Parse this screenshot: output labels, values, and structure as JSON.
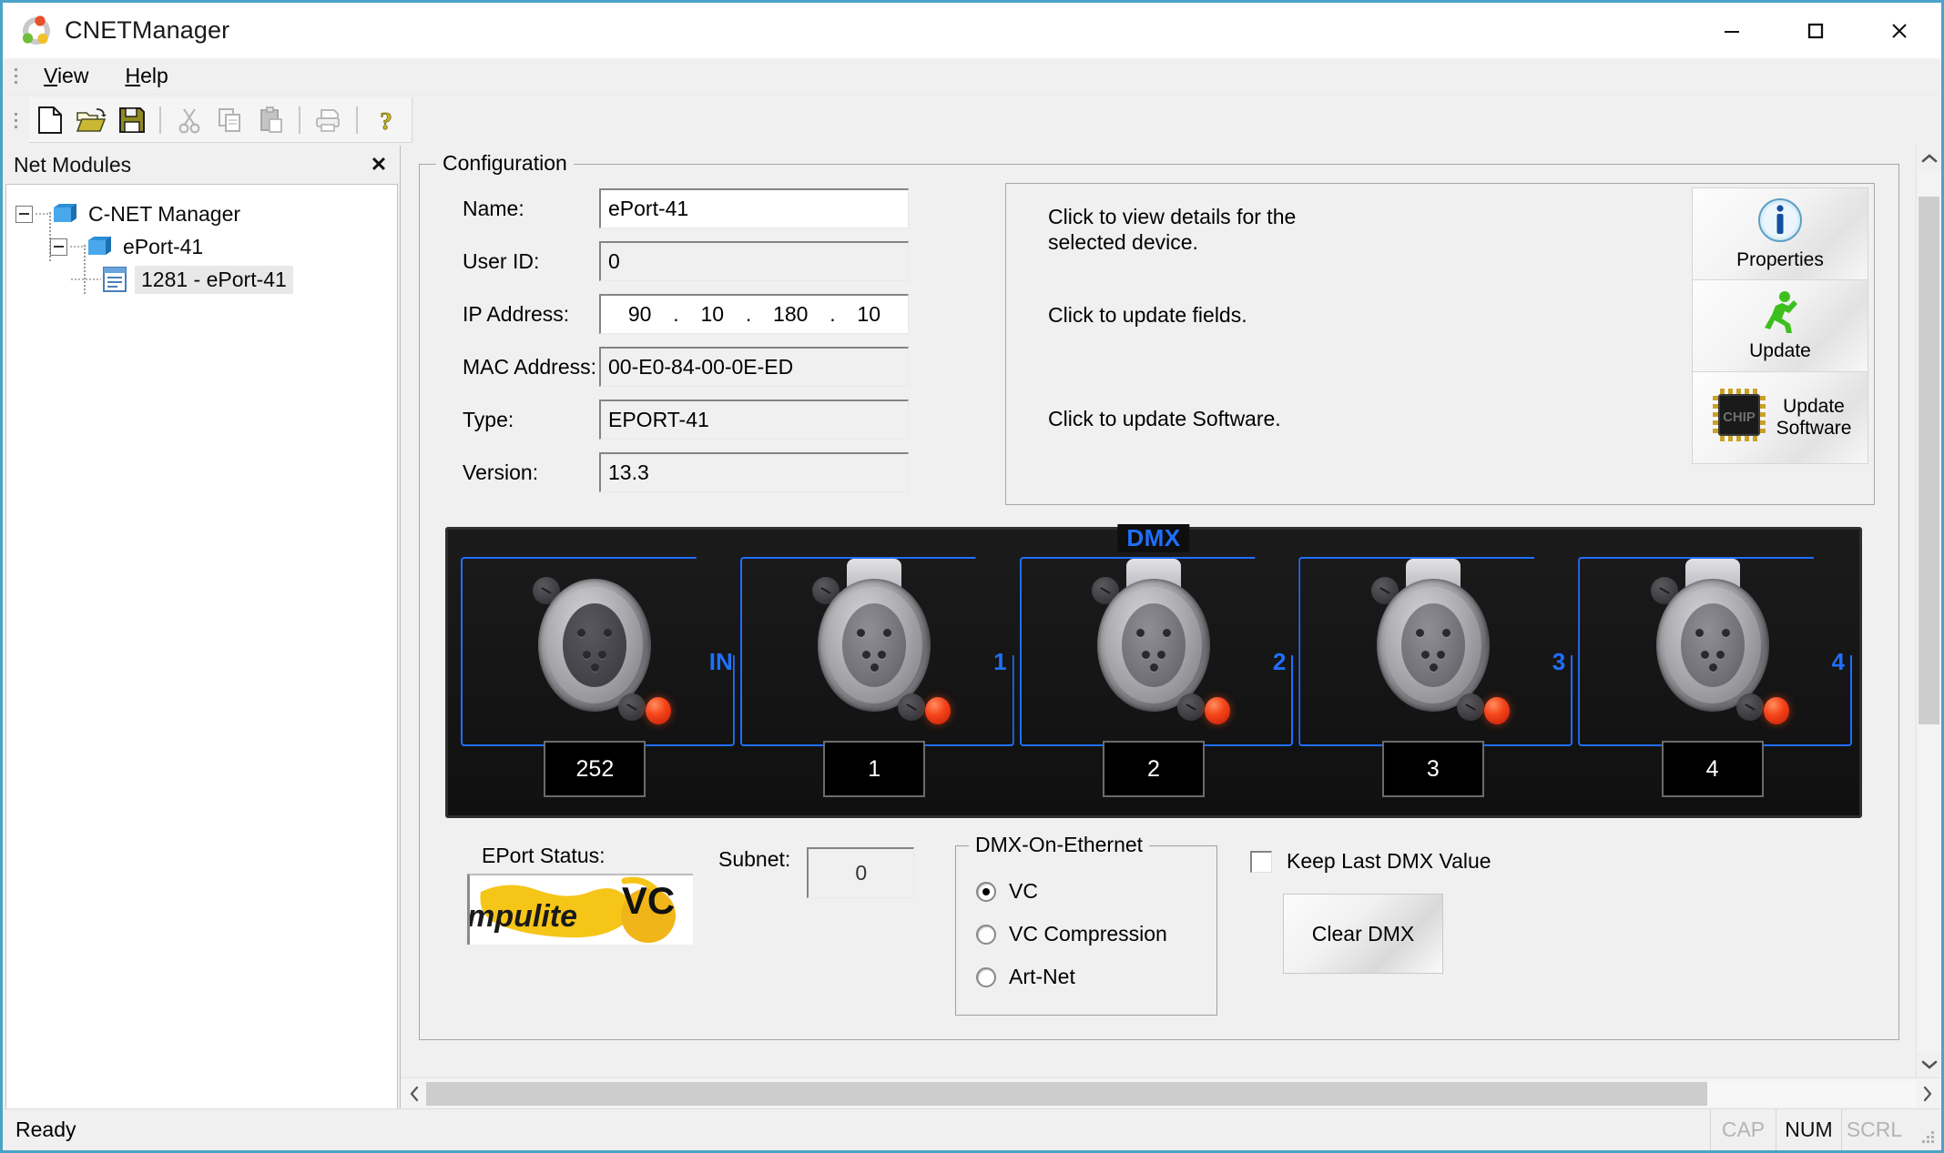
{
  "window": {
    "title": "CNETManager",
    "app_icon": "cnet-logo-icon",
    "minimize_label": "—",
    "maximize_label": "□",
    "close_label": "✕"
  },
  "menubar": {
    "items": [
      {
        "label": "View",
        "accel": "V"
      },
      {
        "label": "Help",
        "accel": "H"
      }
    ]
  },
  "toolbar": {
    "buttons": [
      {
        "name": "new-file-icon",
        "tooltip": "New",
        "enabled": true
      },
      {
        "name": "open-folder-icon",
        "tooltip": "Open",
        "enabled": true
      },
      {
        "name": "save-disk-icon",
        "tooltip": "Save",
        "enabled": true
      },
      {
        "name": "cut-scissors-icon",
        "tooltip": "Cut",
        "enabled": false
      },
      {
        "name": "copy-icon",
        "tooltip": "Copy",
        "enabled": false
      },
      {
        "name": "paste-clipboard-icon",
        "tooltip": "Paste",
        "enabled": false
      },
      {
        "name": "print-icon",
        "tooltip": "Print",
        "enabled": false
      },
      {
        "name": "help-question-icon",
        "tooltip": "Help",
        "enabled": true
      }
    ]
  },
  "dock": {
    "title": "Net Modules",
    "close_label": "✕",
    "tree": [
      {
        "label": "C-NET Manager",
        "level": 1,
        "icon": "folder-icon",
        "expanded": true,
        "selected": false
      },
      {
        "label": "ePort-41",
        "level": 2,
        "icon": "folder-icon",
        "expanded": true,
        "selected": false
      },
      {
        "label": "1281 - ePort-41",
        "level": 3,
        "icon": "document-icon",
        "expanded": false,
        "selected": true
      }
    ]
  },
  "configuration": {
    "legend": "Configuration",
    "fields": [
      {
        "label": "Name:",
        "value": "ePort-41",
        "editable": true,
        "style": "white"
      },
      {
        "label": "User ID:",
        "value": "0",
        "editable": false,
        "style": "gray"
      },
      {
        "label": "IP Address:",
        "value": "",
        "editable": true,
        "style": "white",
        "ip": true
      },
      {
        "label": "MAC Address:",
        "value": "00-E0-84-00-0E-ED",
        "editable": false,
        "style": "gray"
      },
      {
        "label": "Type:",
        "value": "EPORT-41",
        "editable": false,
        "style": "gray"
      },
      {
        "label": "Version:",
        "value": "13.3",
        "editable": false,
        "style": "gray"
      }
    ],
    "ip_octets": [
      "90",
      "10",
      "180",
      "10"
    ],
    "ip_separator": "."
  },
  "actions": {
    "hints": [
      "Click to view details for the\nselected device.",
      "Click to update fields.",
      "Click to update Software."
    ],
    "buttons": [
      {
        "label": "Properties",
        "icon": "info-circle-icon"
      },
      {
        "label": "Update",
        "icon": "running-man-icon"
      },
      {
        "label": "Update\nSoftware",
        "icon": "chip-icon"
      }
    ]
  },
  "dmx_panel": {
    "title": "DMX",
    "ports": [
      {
        "label": "IN",
        "value": "252",
        "led": true,
        "has_tab": false,
        "direction": "input"
      },
      {
        "label": "1",
        "value": "1",
        "led": true,
        "has_tab": true,
        "direction": "output"
      },
      {
        "label": "2",
        "value": "2",
        "led": true,
        "has_tab": true,
        "direction": "output"
      },
      {
        "label": "3",
        "value": "3",
        "led": true,
        "has_tab": true,
        "direction": "output"
      },
      {
        "label": "4",
        "value": "4",
        "led": true,
        "has_tab": true,
        "direction": "output"
      }
    ],
    "outline_color": "#1f6fff",
    "led_color": "#f5441a",
    "background_color": "#101010"
  },
  "status_panel": {
    "eport_status_label": "EPort Status:",
    "logo_brand": "compulite",
    "logo_product": "VC",
    "logo_colors": {
      "brush": "#f5c518",
      "text": "#1a1a1a"
    }
  },
  "subnet": {
    "label": "Subnet:",
    "value": "0"
  },
  "dmx_on_ethernet": {
    "legend": "DMX-On-Ethernet",
    "options": [
      {
        "label": "VC",
        "selected": true
      },
      {
        "label": "VC Compression",
        "selected": false
      },
      {
        "label": "Art-Net",
        "selected": false
      }
    ]
  },
  "keep_dmx": {
    "label": "Keep Last DMX Value",
    "checked": false
  },
  "clear_dmx": {
    "label": "Clear DMX"
  },
  "scrollbars": {
    "vertical_up": "⌃",
    "vertical_down": "⌄",
    "horizontal_left": "‹",
    "horizontal_right": "›"
  },
  "statusbar": {
    "message": "Ready",
    "indicators": [
      {
        "label": "CAP",
        "active": false
      },
      {
        "label": "NUM",
        "active": true
      },
      {
        "label": "SCRL",
        "active": false
      }
    ]
  }
}
